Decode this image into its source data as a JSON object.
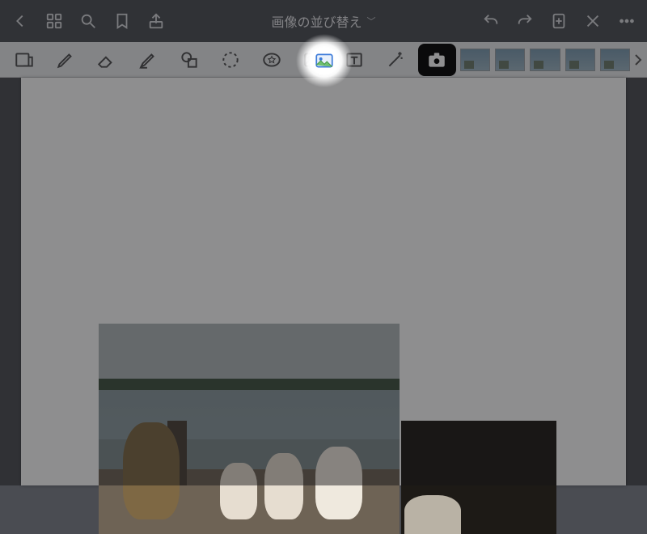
{
  "header": {
    "title": "画像の並び替え"
  },
  "icons": {
    "back": "back-icon",
    "grid": "grid-icon",
    "search": "search-icon",
    "bookmark": "bookmark-icon",
    "share": "share-icon",
    "undo": "undo-icon",
    "redo": "redo-icon",
    "add_page": "add-page-icon",
    "close": "close-icon",
    "more": "more-icon"
  },
  "toolbar": {
    "tools": [
      "zoom-region",
      "pen",
      "eraser",
      "highlighter",
      "shapes",
      "lasso",
      "favorite",
      "image",
      "text",
      "magic"
    ],
    "highlighted_tool": "image",
    "active_tool": "camera"
  },
  "canvas": {
    "images": [
      {
        "id": "photo-dogs-on-dock"
      },
      {
        "id": "photo-cat-dark"
      }
    ]
  }
}
